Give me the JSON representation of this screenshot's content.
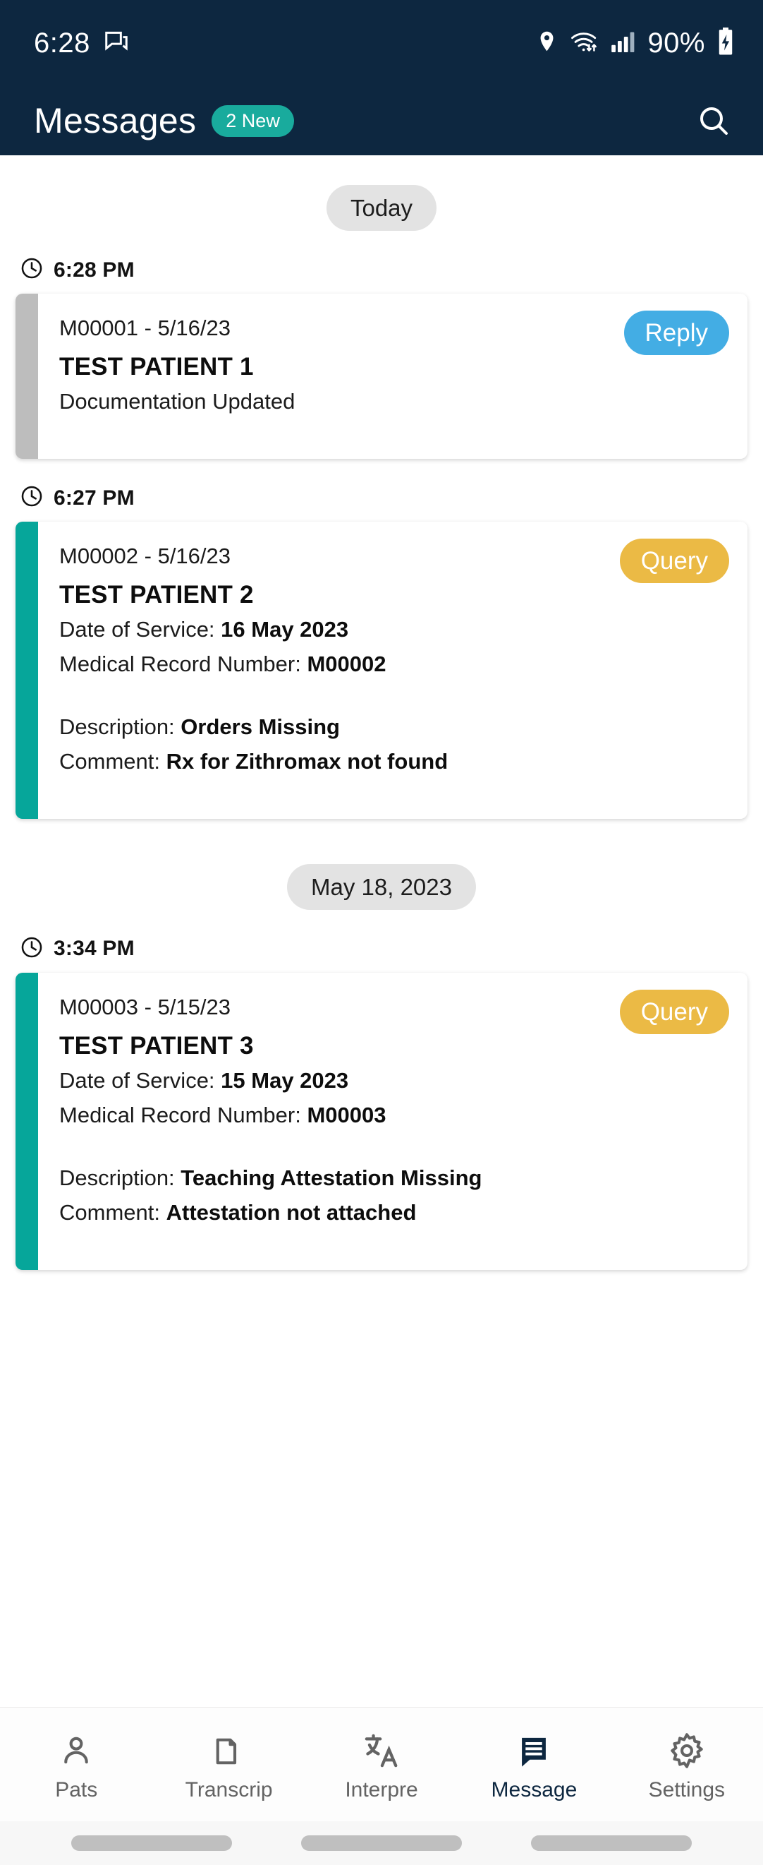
{
  "status_bar": {
    "time": "6:28",
    "battery_percent": "90%",
    "icons": [
      "chat-bubble-icon",
      "location-pin-icon",
      "wifi-icon",
      "cellular-signal-icon",
      "battery-charging-icon"
    ]
  },
  "app_bar": {
    "title": "Messages",
    "badge": "2 New",
    "search_icon": "search-icon"
  },
  "theme": {
    "navy": "#0d2740",
    "teal": "#06a69a",
    "badge_teal": "#19ab9d",
    "reply_blue": "#43ade4",
    "query_gold": "#ebba45",
    "gray_accent": "#bdbdbd",
    "pill_gray": "#e3e3e3"
  },
  "groups": [
    {
      "date_label": "Today",
      "entries": [
        {
          "time": "6:28 PM",
          "card": {
            "accent": "gray",
            "id_line": "M00001 - 5/16/23",
            "chip_label": "Reply",
            "chip_type": "reply",
            "patient_name": "TEST PATIENT 1",
            "lines": [
              {
                "label": "Documentation Updated",
                "value": ""
              }
            ]
          }
        },
        {
          "time": "6:27 PM",
          "card": {
            "accent": "teal",
            "id_line": "M00002 - 5/16/23",
            "chip_label": "Query",
            "chip_type": "query",
            "patient_name": "TEST PATIENT 2",
            "lines": [
              {
                "label": "Date of Service: ",
                "value": "16 May 2023"
              },
              {
                "label": "Medical Record Number: ",
                "value": "M00002"
              }
            ],
            "lines2": [
              {
                "label": "Description: ",
                "value": "Orders Missing"
              },
              {
                "label": "Comment: ",
                "value": "Rx for Zithromax not found"
              }
            ]
          }
        }
      ]
    },
    {
      "date_label": "May 18, 2023",
      "entries": [
        {
          "time": "3:34 PM",
          "card": {
            "accent": "teal",
            "id_line": "M00003 - 5/15/23",
            "chip_label": "Query",
            "chip_type": "query",
            "patient_name": "TEST PATIENT 3",
            "lines": [
              {
                "label": "Date of Service: ",
                "value": "15 May 2023"
              },
              {
                "label": "Medical Record Number: ",
                "value": "M00003"
              }
            ],
            "lines2": [
              {
                "label": "Description: ",
                "value": "Teaching Attestation Missing"
              },
              {
                "label": "Comment: ",
                "value": "Attestation not attached"
              }
            ]
          }
        }
      ]
    }
  ],
  "bottom_nav": {
    "items": [
      {
        "label": "Pats",
        "icon": "person-icon",
        "active": false
      },
      {
        "label": "Transcrip",
        "icon": "folder-icon",
        "active": false
      },
      {
        "label": "Interpre",
        "icon": "translate-icon",
        "active": false
      },
      {
        "label": "Message",
        "icon": "message-icon",
        "active": true
      },
      {
        "label": "Settings",
        "icon": "gear-icon",
        "active": false
      }
    ]
  }
}
